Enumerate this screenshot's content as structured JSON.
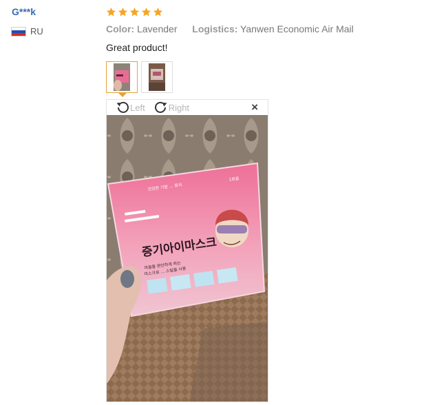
{
  "reviewer": {
    "name": "G***k",
    "country": "RU",
    "flag_colors": [
      "#ffffff",
      "#1d4fb4",
      "#d52b1e"
    ]
  },
  "review": {
    "rating": 5,
    "max_rating": 5,
    "star_color": "#f5a623",
    "color_label": "Color:",
    "color_value": "Lavender",
    "logistics_label": "Logistics:",
    "logistics_value": "Yanwen Economic Air Mail",
    "text": "Great product!"
  },
  "photo_viewer": {
    "thumbnails": [
      "photo-1",
      "photo-2"
    ],
    "selected_index": 0,
    "rotate_left_label": "Left",
    "rotate_right_label": "Right",
    "close_glyph": "×",
    "accent_color": "#e5a235"
  },
  "product_photo": {
    "packet_heading": "증기아이마스크",
    "packet_small_lines": [
      "건강한 기분 ... 휴식",
      "마음을 편안하게 하는",
      "마스크로 ... 스팀을 사용"
    ],
    "packet_badge": "1회용",
    "packet_color": "#ef6f9a"
  }
}
